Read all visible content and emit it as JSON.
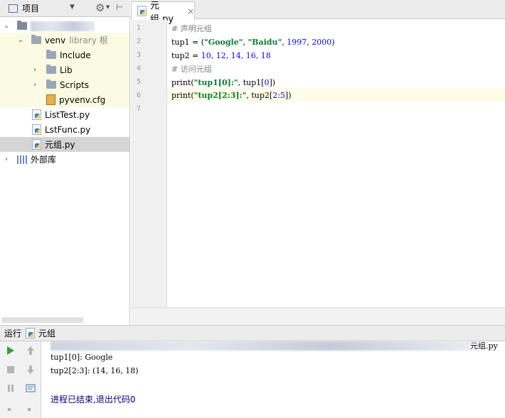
{
  "project_panel": {
    "title": "项目",
    "root_label": "",
    "tree": [
      {
        "label": "venv",
        "hint": "library 根"
      },
      {
        "label": "Include"
      },
      {
        "label": "Lib"
      },
      {
        "label": "Scripts"
      },
      {
        "label": "pyvenv.cfg"
      },
      {
        "label": "ListTest.py"
      },
      {
        "label": "LstFunc.py"
      },
      {
        "label": "元组.py"
      },
      {
        "label": "外部库"
      }
    ]
  },
  "editor": {
    "tab_label": "元组.py",
    "tab_close": "×",
    "line_numbers": [
      "1",
      "2",
      "3",
      "4",
      "5",
      "6",
      "7"
    ],
    "lines": {
      "l1": "# 声明元组",
      "l2_a": "tup1 = (",
      "l2_s1": "\"Google\"",
      "l2_b": ", ",
      "l2_s2": "\"Baidu\"",
      "l2_c": ", ",
      "l2_n1": "1997",
      "l2_d": ", ",
      "l2_n2": "2000",
      "l2_e": ")",
      "l3_a": "tup2 = ",
      "l3_n": "10, 12, 14, 16, 18",
      "l4": "# 访问元组",
      "l5_a": "print(",
      "l5_s": "\"tup1[0]:\"",
      "l5_b": ", tup1[",
      "l5_n": "0",
      "l5_c": "])",
      "l6_a": "print(",
      "l6_s": "\"tup2[2:3]:\"",
      "l6_b": ", tup2[",
      "l6_n1": "2",
      "l6_c": ":",
      "l6_n2": "5",
      "l6_d": "])"
    }
  },
  "run_panel": {
    "label": "运行",
    "config_name": "元组",
    "output": {
      "command_tail": "元组.py",
      "line1": "tup1[0]: Google",
      "line2": "tup2[2:3]: (14, 16, 18)",
      "exit_message": "进程已结束,退出代码0"
    }
  },
  "colors": {
    "string": "#057d32",
    "number": "#0000ff",
    "comment": "#808080",
    "run_green": "#2ea043",
    "exit_text": "#00007f"
  }
}
